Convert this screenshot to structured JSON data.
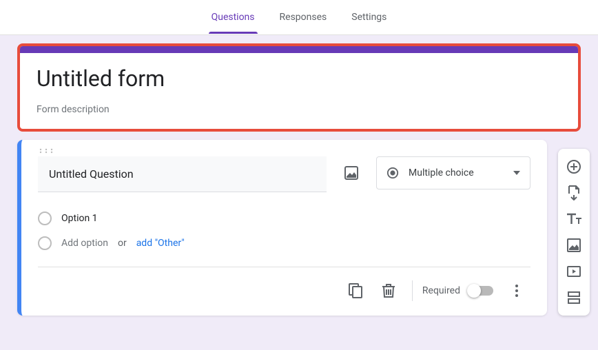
{
  "tabs": {
    "questions": "Questions",
    "responses": "Responses",
    "settings": "Settings"
  },
  "header": {
    "title": "Untitled form",
    "description": "Form description"
  },
  "question": {
    "title": "Untitled Question",
    "type_label": "Multiple choice",
    "option1": "Option 1",
    "add_option": "Add option",
    "or": "or",
    "add_other": "add \"Other\""
  },
  "footer": {
    "required": "Required"
  },
  "colors": {
    "accent": "#673ab7",
    "highlight_border": "#e74c3c",
    "selected_border": "#4285f4",
    "link": "#1a73e8"
  }
}
